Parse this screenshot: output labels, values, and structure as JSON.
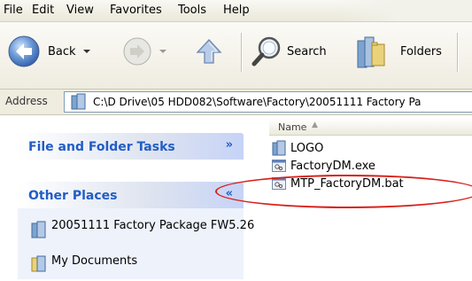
{
  "menu": {
    "items": [
      "File",
      "Edit",
      "View",
      "Favorites",
      "Tools",
      "Help"
    ]
  },
  "toolbar": {
    "back_label": "Back",
    "search_label": "Search",
    "folders_label": "Folders"
  },
  "address": {
    "label": "Address",
    "path": "C:\\D Drive\\05 HDD082\\Software\\Factory\\20051111 Factory Pa"
  },
  "tasks": {
    "file_folder_tasks": "File and Folder Tasks",
    "other_places": "Other Places",
    "places": [
      "20051111 Factory Package FW5.26",
      "My Documents"
    ]
  },
  "files": {
    "column_name": "Name",
    "items": [
      "LOGO",
      "FactoryDM.exe",
      "MTP_FactoryDM.bat"
    ]
  },
  "colors": {
    "accent_blue": "#215dc6",
    "highlight_red": "#d8201a"
  }
}
